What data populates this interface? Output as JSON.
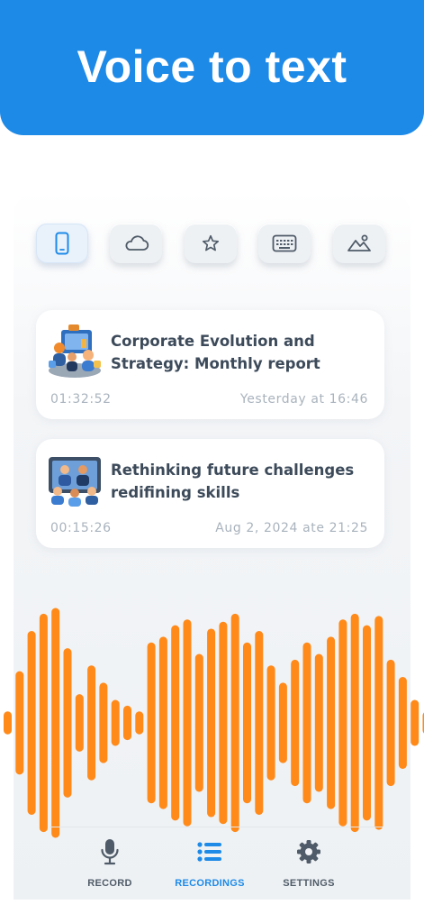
{
  "banner": {
    "title": "Voice to text"
  },
  "colors": {
    "brand_blue": "#1d8ae8",
    "waveform_orange": "#ff8a1a",
    "title_text": "#3c4a5a",
    "meta_text": "#a9b3bd"
  },
  "filters": [
    {
      "icon": "phone-icon",
      "active": true
    },
    {
      "icon": "cloud-icon",
      "active": false
    },
    {
      "icon": "star-icon",
      "active": false
    },
    {
      "icon": "keyboard-icon",
      "active": false
    },
    {
      "icon": "image-icon",
      "active": false
    }
  ],
  "recordings": [
    {
      "title": "Corporate Evolution and Strategy: Monthly report",
      "duration": "01:32:52",
      "date": "Yesterday at 16:46",
      "thumbnail": "business-meeting-illustration"
    },
    {
      "title": "Rethinking future challenges redifining skills",
      "duration": "00:15:26",
      "date": "Aug 2, 2024 ate 21:25",
      "thumbnail": "video-conference-illustration"
    }
  ],
  "tabbar": {
    "active": "recordings",
    "items": [
      {
        "id": "record",
        "label": "RECORD",
        "icon": "microphone-icon"
      },
      {
        "id": "recordings",
        "label": "RECORDINGS",
        "icon": "list-icon"
      },
      {
        "id": "settings",
        "label": "SETTINGS",
        "icon": "gear-icon"
      }
    ]
  },
  "waveform": {
    "levels": [
      0.1,
      0.45,
      0.8,
      0.95,
      1.0,
      0.65,
      0.25,
      0.5,
      0.35,
      0.2,
      0.15,
      0.1,
      0.7,
      0.75,
      0.85,
      0.9,
      0.6,
      0.82,
      0.88,
      0.95,
      0.7,
      0.8,
      0.5,
      0.35,
      0.55,
      0.7,
      0.6,
      0.75,
      0.9,
      0.95,
      0.85,
      0.93,
      0.55,
      0.4,
      0.2,
      0.1
    ]
  }
}
